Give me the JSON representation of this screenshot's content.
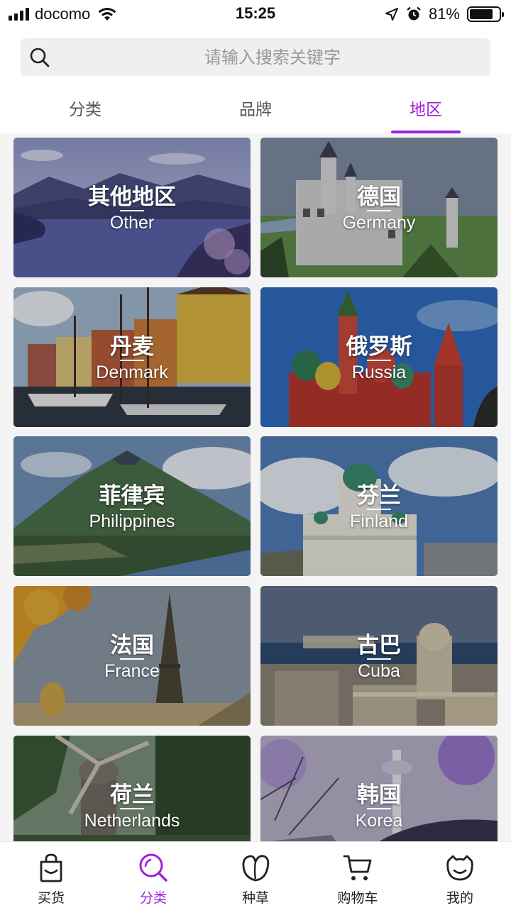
{
  "status_bar": {
    "carrier": "docomo",
    "time": "15:25",
    "battery_percent": "81%",
    "battery_level": 0.81,
    "icons": [
      "signal-icon",
      "wifi-icon",
      "location-arrow-icon",
      "alarm-icon",
      "battery-icon"
    ]
  },
  "search": {
    "placeholder": "请输入搜索关键字",
    "value": ""
  },
  "tabs": [
    {
      "label": "分类",
      "active": false
    },
    {
      "label": "品牌",
      "active": false
    },
    {
      "label": "地区",
      "active": true
    }
  ],
  "regions": [
    {
      "cn": "其他地区",
      "en": "Other"
    },
    {
      "cn": "德国",
      "en": "Germany"
    },
    {
      "cn": "丹麦",
      "en": "Denmark"
    },
    {
      "cn": "俄罗斯",
      "en": "Russia"
    },
    {
      "cn": "菲律宾",
      "en": "Philippines"
    },
    {
      "cn": "芬兰",
      "en": "Finland"
    },
    {
      "cn": "法国",
      "en": "France"
    },
    {
      "cn": "古巴",
      "en": "Cuba"
    },
    {
      "cn": "荷兰",
      "en": "Netherlands"
    },
    {
      "cn": "韩国",
      "en": "Korea"
    }
  ],
  "bottom_nav": [
    {
      "label": "买货",
      "icon": "shopping-bag-icon",
      "active": false
    },
    {
      "label": "分类",
      "icon": "search-icon",
      "active": true
    },
    {
      "label": "种草",
      "icon": "leaf-icon",
      "active": false
    },
    {
      "label": "购物车",
      "icon": "cart-icon",
      "active": false
    },
    {
      "label": "我的",
      "icon": "profile-icon",
      "active": false
    }
  ],
  "colors": {
    "accent": "#a020d8",
    "search_bg": "#efefef"
  }
}
